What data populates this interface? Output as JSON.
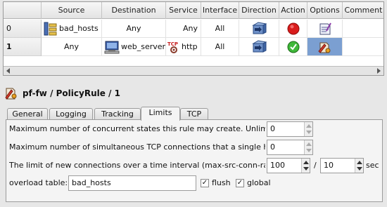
{
  "table": {
    "columns": [
      "Source",
      "Destination",
      "Service",
      "Interface",
      "Direction",
      "Action",
      "Options",
      "Comment"
    ],
    "rows": [
      {
        "num": "0",
        "source": "bad_hosts",
        "destination": "Any",
        "service": "Any",
        "interface": "All",
        "direction_icon": "direction-both-icon",
        "action_icon": "deny-icon",
        "options_icon": "options-note-icon"
      },
      {
        "num": "1",
        "source": "Any",
        "destination": "web_server",
        "service": "http",
        "interface": "All",
        "direction_icon": "direction-both-icon",
        "action_icon": "accept-icon",
        "options_icon": "options-limit-icon"
      }
    ]
  },
  "panel": {
    "title": "pf-fw / PolicyRule / 1",
    "tabs": [
      "General",
      "Logging",
      "Tracking",
      "Limits",
      "TCP"
    ],
    "active_tab": "Limits",
    "fields": {
      "max_states_label": "Maximum number of concurrent states this rule may create. Unlimit",
      "max_states_value": "0",
      "max_tcp_label": "Maximum number of simultaneous TCP connections that a single ho",
      "max_tcp_value": "0",
      "conn_rate_label": "The limit of new connections over a time interval (max-src-conn-rat",
      "conn_rate_count": "100",
      "conn_rate_slash": "/",
      "conn_rate_interval": "10",
      "conn_rate_unit": "sec",
      "overload_label": "overload table:",
      "overload_value": "bad_hosts",
      "flush_label": "flush",
      "flush_checked": true,
      "global_label": "global",
      "global_checked": true,
      "check_mark": "✓"
    }
  }
}
